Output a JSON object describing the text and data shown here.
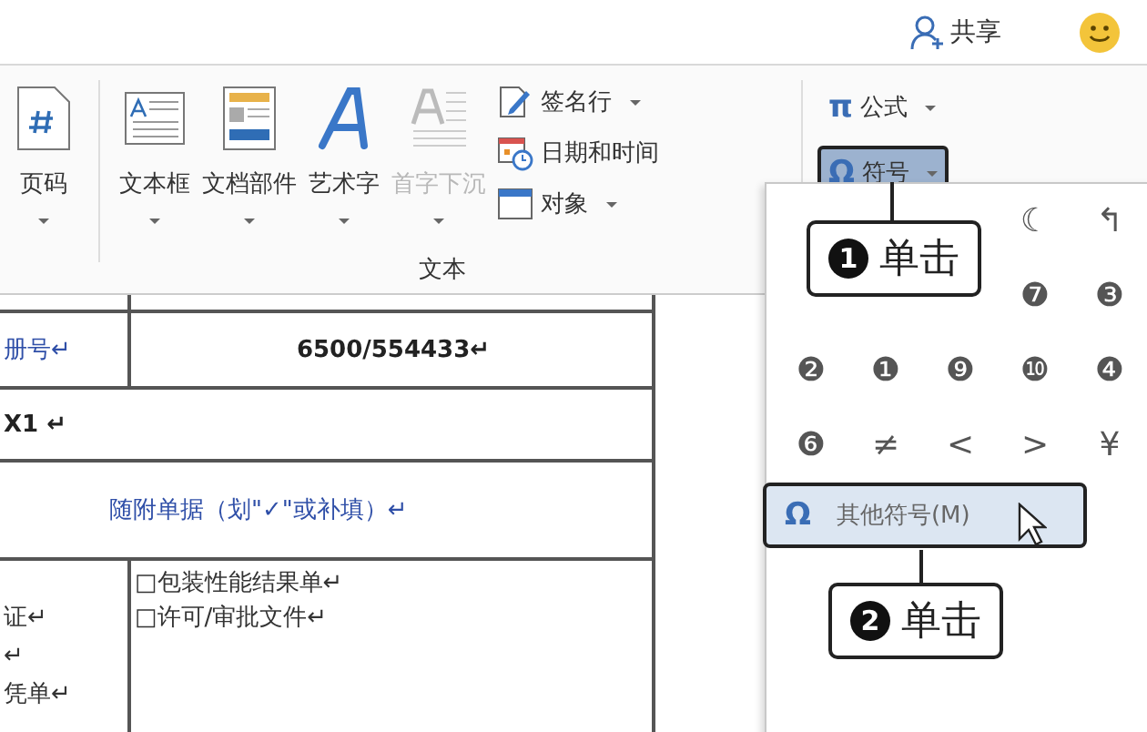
{
  "account": {
    "share": "共享"
  },
  "ribbon": {
    "large_buttons": [
      {
        "kind": "page-number",
        "label": "页码",
        "disabled": false
      },
      {
        "kind": "text-box",
        "label": "文本框",
        "disabled": false
      },
      {
        "kind": "quick-parts",
        "label": "文档部件",
        "disabled": false
      },
      {
        "kind": "word-art",
        "label": "艺术字",
        "disabled": false
      },
      {
        "kind": "drop-cap",
        "label": "首字下沉",
        "disabled": true
      }
    ],
    "small_buttons": [
      {
        "kind": "signature",
        "label": "签名行",
        "dropdown": true
      },
      {
        "kind": "date",
        "label": "日期和时间",
        "dropdown": false
      },
      {
        "kind": "object",
        "label": "对象",
        "dropdown": true
      }
    ],
    "group_label": "文本",
    "symbol_buttons": [
      {
        "glyph": "π",
        "label": "公式",
        "selected": false
      },
      {
        "glyph": "Ω",
        "label": "符号",
        "selected": true
      }
    ]
  },
  "symbol_panel": {
    "rows": [
      [
        null,
        null,
        null,
        {
          "glyph": "☾"
        },
        {
          "glyph": "↰"
        }
      ],
      [
        null,
        null,
        null,
        {
          "glyph": "❼"
        },
        {
          "glyph": "❸"
        }
      ],
      [
        {
          "glyph": "❷"
        },
        {
          "glyph": "❶"
        },
        {
          "glyph": "❾"
        },
        {
          "glyph": "❿"
        },
        {
          "glyph": "❹"
        }
      ],
      [
        {
          "glyph": "❻"
        },
        {
          "glyph": "≠"
        },
        {
          "glyph": "<"
        },
        {
          "glyph": ">"
        },
        {
          "glyph": "¥"
        }
      ]
    ],
    "more": {
      "glyph": "Ω",
      "label": "其他符号(M)",
      "selected": true
    }
  },
  "callouts": [
    {
      "number": "1",
      "text": "单击"
    },
    {
      "number": "2",
      "text": "单击"
    }
  ],
  "table": {
    "rows": [
      {
        "kind": "pair",
        "cells": [
          "册号↵",
          "6500/554433↵"
        ]
      },
      {
        "kind": "span",
        "cells": [
          "X1 ↵"
        ]
      },
      {
        "kind": "heading",
        "cells": [
          "随附单据（划\"✓\"或补填）↵"
        ]
      },
      {
        "kind": "list",
        "cells": [
          "证↵\n↵\n凭单↵",
          "□包装性能结果单↵\n□许可/审批文件↵"
        ]
      }
    ]
  }
}
